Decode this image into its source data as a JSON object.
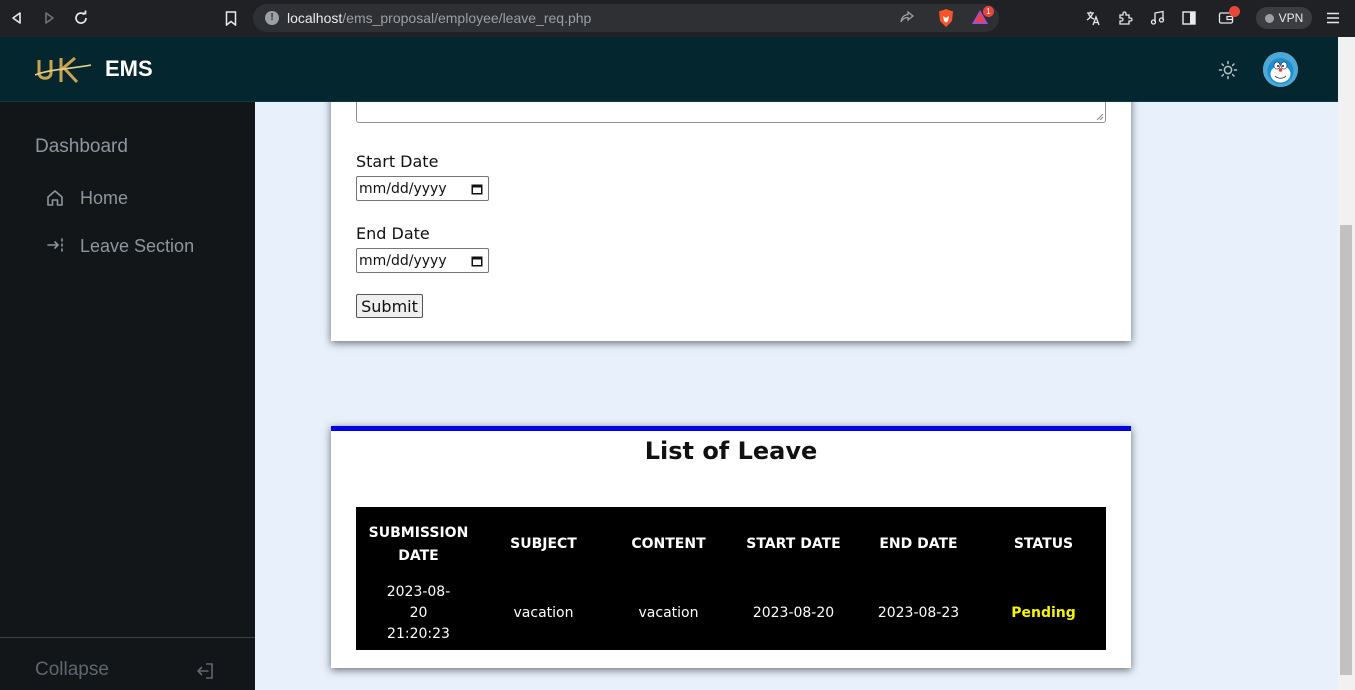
{
  "browser": {
    "url_host": "localhost",
    "url_path": "/ems_proposal/employee/leave_req.php",
    "brave_alerts_badge": "1",
    "vpn_label": "VPN"
  },
  "header": {
    "app_title": "EMS",
    "logo_icon": "uk-logo",
    "theme_icon": "sun-icon"
  },
  "sidebar": {
    "heading": "Dashboard",
    "items": [
      {
        "label": "Home",
        "icon": "home-icon"
      },
      {
        "label": "Leave Section",
        "icon": "leave-arrow-icon"
      }
    ],
    "collapse_label": "Collapse"
  },
  "form": {
    "start_label": "Start Date",
    "start_value": "mm/dd/yyyy",
    "end_label": "End Date",
    "end_value": "mm/dd/yyyy",
    "submit_label": "Submit"
  },
  "leave_list": {
    "title": "List of Leave",
    "columns": [
      "SUBMISSION DATE",
      "SUBJECT",
      "CONTENT",
      "START DATE",
      "END DATE",
      "STATUS"
    ],
    "rows": [
      {
        "submission_date": "2023-08-20 21:20:23",
        "subject": "vacation",
        "content": "vacation",
        "start_date": "2023-08-20",
        "end_date": "2023-08-23",
        "status": "Pending"
      }
    ]
  },
  "colors": {
    "header_bg": "#04262e",
    "sidebar_bg": "#131619",
    "main_bg": "#e7f0fb",
    "card_accent": "#0000e6",
    "status_pending": "#f5f500"
  }
}
